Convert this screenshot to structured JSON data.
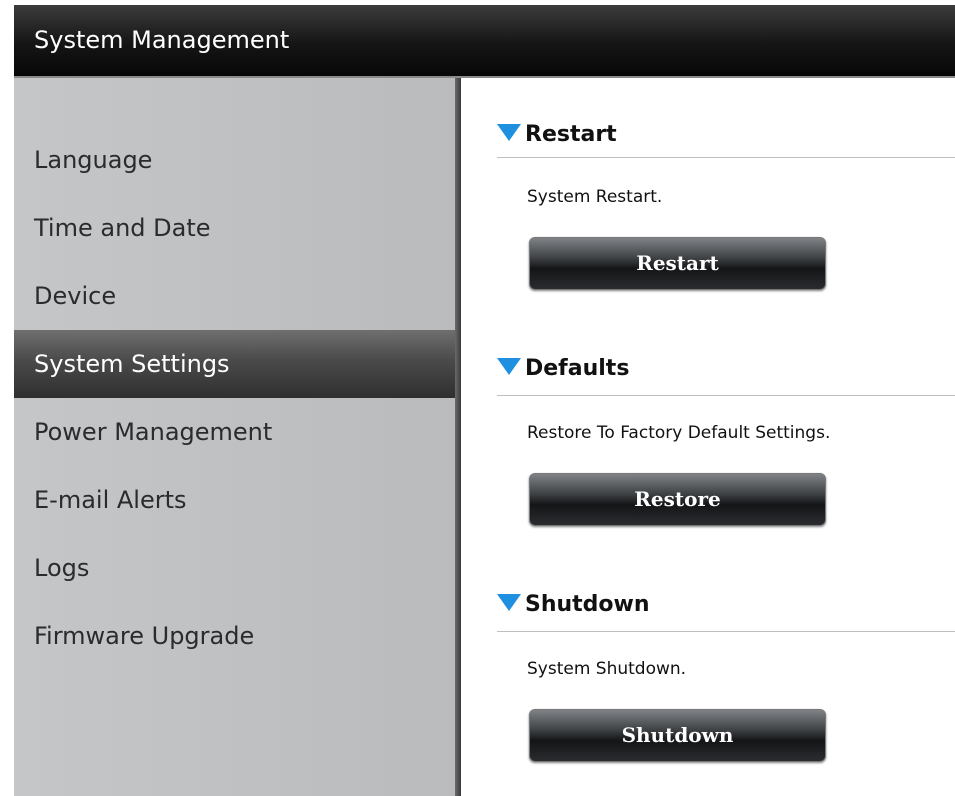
{
  "header": {
    "title": "System Management"
  },
  "sidebar": {
    "items": [
      {
        "label": "Language"
      },
      {
        "label": "Time and Date"
      },
      {
        "label": "Device"
      },
      {
        "label": "System Settings",
        "active": true
      },
      {
        "label": "Power Management"
      },
      {
        "label": "E-mail Alerts"
      },
      {
        "label": "Logs"
      },
      {
        "label": "Firmware Upgrade"
      }
    ]
  },
  "sections": {
    "restart": {
      "title": "Restart",
      "description": "System Restart.",
      "button": "Restart"
    },
    "defaults": {
      "title": "Defaults",
      "description": "Restore To Factory Default Settings.",
      "button": "Restore"
    },
    "shutdown": {
      "title": "Shutdown",
      "description": "System Shutdown.",
      "button": "Shutdown"
    }
  },
  "colors": {
    "accent_triangle": "#1f8fe0",
    "header_bg": "#070707",
    "sidebar_bg": "#c4c6c8",
    "active_item_bg": "#4a4a4a"
  },
  "icons": {
    "section_marker": "triangle-down-icon"
  }
}
